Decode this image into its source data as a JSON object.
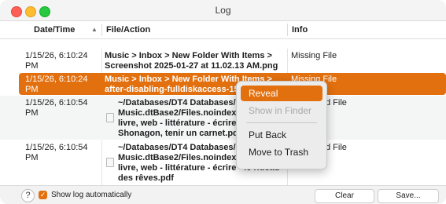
{
  "window": {
    "title": "Log"
  },
  "columns": {
    "date": "Date/Time",
    "file": "File/Action",
    "info": "Info"
  },
  "rows": [
    {
      "date": "1/15/26, 6:10:24 PM",
      "file": "Music > Inbox > New Folder With Items >\nScreenshot 2025-01-27 at 11.02.13 AM.png",
      "info": "Missing File"
    },
    {
      "date": "1/15/26, 6:10:24 PM",
      "file": "Music > Inbox > New Folder With Items >\nafter-disabling-fulldiskaccess-15",
      "info": "Missing File"
    },
    {
      "date": "1/15/26, 6:10:54 PM",
      "file": "~/Databases/DT4 Databases/\nMusic.dtBase2/Files.noindex/p\nlivre, web - littérature - écrire\nShonagon, tenir un carnet.pdf",
      "info": "d File"
    },
    {
      "date": "1/15/26, 6:10:54 PM",
      "file": "~/Databases/DT4 Databases/\nMusic.dtBase2/Files.noindex/p\nlivre, web - littérature - écrire - le rideau\ndes rêves.pdf",
      "info": "d File"
    }
  ],
  "context_menu": {
    "reveal": "Reveal",
    "show_in_finder": "Show in Finder",
    "put_back": "Put Back",
    "move_to_trash": "Move to Trash"
  },
  "footer": {
    "help": "?",
    "show_log_label": "Show log automatically",
    "show_log_checked": true,
    "clear": "Clear",
    "save": "Save..."
  },
  "colors": {
    "accent": "#e2700f"
  }
}
